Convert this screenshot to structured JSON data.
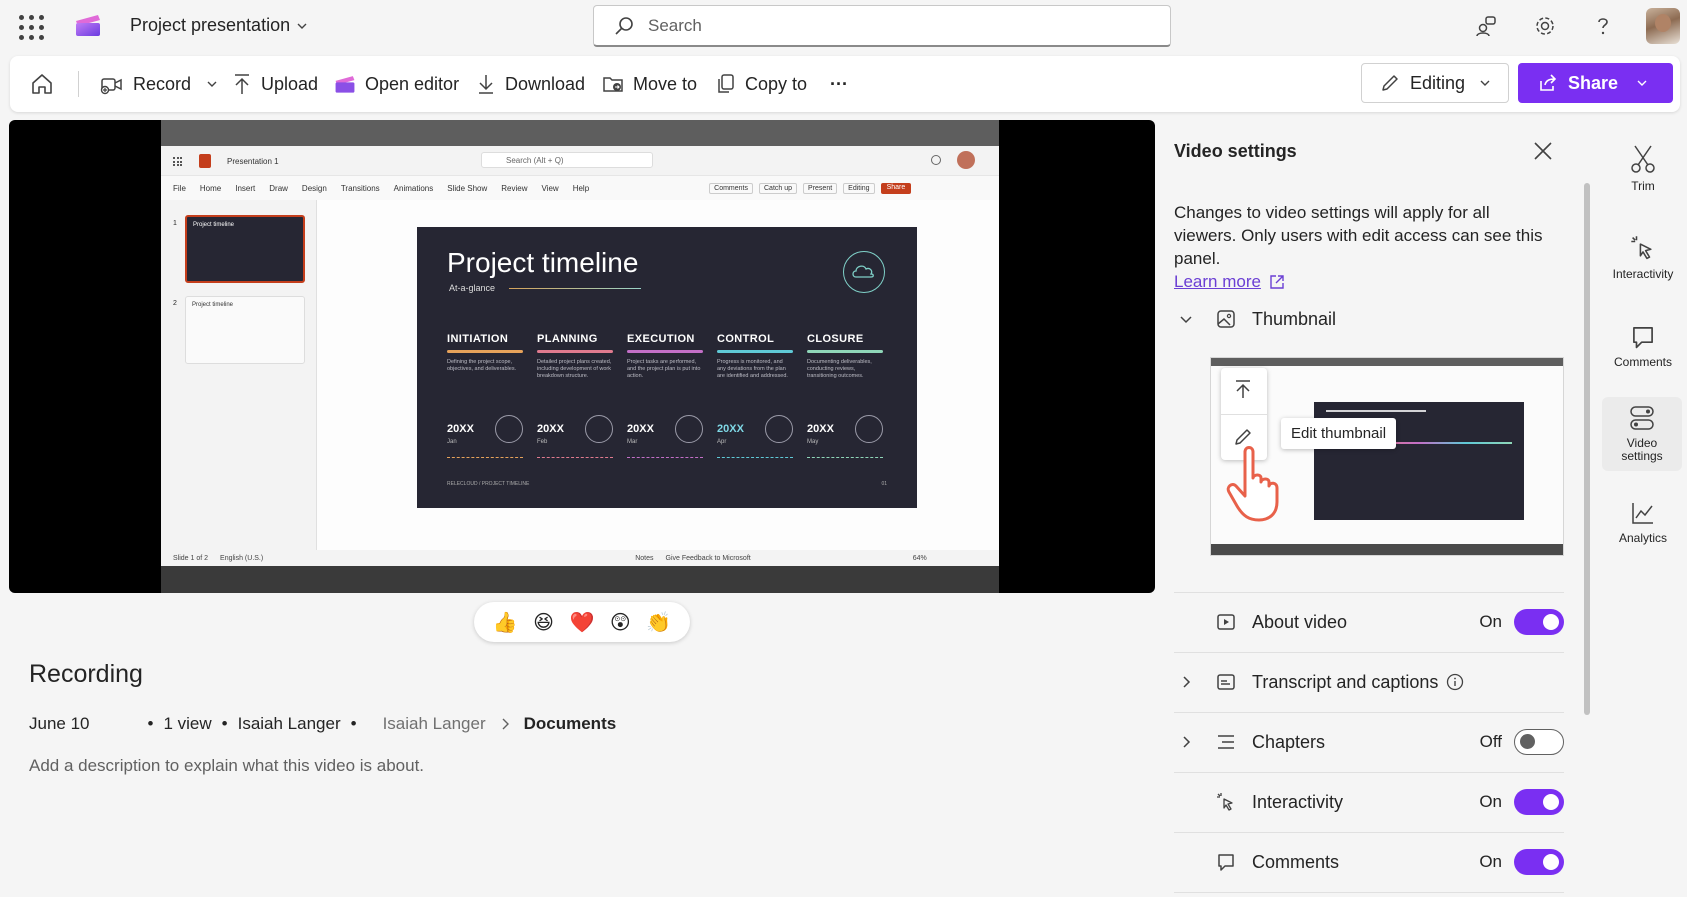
{
  "topbar": {
    "title": "Project presentation",
    "search_placeholder": "Search"
  },
  "toolbar": {
    "record": "Record",
    "upload": "Upload",
    "open_editor": "Open editor",
    "download": "Download",
    "move_to": "Move to",
    "copy_to": "Copy to",
    "more": "···",
    "editing": "Editing",
    "share": "Share"
  },
  "video": {
    "ppt": {
      "app_title": "Presentation 1",
      "search": "Search (Alt + Q)",
      "menu": [
        "File",
        "Home",
        "Insert",
        "Draw",
        "Design",
        "Transitions",
        "Animations",
        "Slide Show",
        "Review",
        "View",
        "Help"
      ],
      "buttons": [
        "Comments",
        "Catch up",
        "Present",
        "Editing",
        "Share"
      ],
      "thumb1_title": "Project timeline",
      "thumb2_title": "Project timeline",
      "status_left": "Slide 1 of 2",
      "status_lang": "English (U.S.)",
      "status_notes": "Notes",
      "status_feedback": "Give Feedback to Microsoft",
      "status_zoom": "64%"
    },
    "slide": {
      "title": "Project timeline",
      "subtitle": "At-a-glance",
      "footer": "RELECLOUD / PROJECT TIMELINE",
      "page": "01",
      "phases": [
        {
          "name": "INITIATION",
          "color": "#e6a25a",
          "desc": "Defining the project scope, objectives, and deliverables.",
          "year": "20XX",
          "month": "Jan"
        },
        {
          "name": "PLANNING",
          "color": "#e07a8e",
          "desc": "Detailed project plans created, including development of work breakdown structure.",
          "year": "20XX",
          "month": "Feb"
        },
        {
          "name": "EXECUTION",
          "color": "#c36fc7",
          "desc": "Project tasks are performed, and the project plan is put into action.",
          "year": "20XX",
          "month": "Mar"
        },
        {
          "name": "CONTROL",
          "color": "#5fc9d6",
          "desc": "Progress is monitored, and any deviations from the plan are identified and addressed.",
          "year": "20XX",
          "month": "Apr"
        },
        {
          "name": "CLOSURE",
          "color": "#8fd6b8",
          "desc": "Documenting deliverables, conducting reviews, transitioning outcomes.",
          "year": "20XX",
          "month": "May"
        }
      ]
    }
  },
  "reactions": [
    "👍",
    "😆",
    "❤️",
    "😲",
    "👏"
  ],
  "info": {
    "title": "Recording",
    "date": "June 10",
    "views": "1 view",
    "author": "Isaiah Langer",
    "path_owner": "Isaiah Langer",
    "path_folder": "Documents",
    "description": "Add a description to explain what this video is about."
  },
  "settings": {
    "title": "Video settings",
    "intro": "Changes to video settings will apply for all viewers. Only users with edit access can see this panel.",
    "learn_more": "Learn more",
    "thumbnail_label": "Thumbnail",
    "edit_thumbnail": "Edit thumbnail",
    "about_video": {
      "label": "About video",
      "state": "On",
      "on": true
    },
    "transcript": {
      "label": "Transcript and captions"
    },
    "chapters": {
      "label": "Chapters",
      "state": "Off",
      "on": false
    },
    "interactivity": {
      "label": "Interactivity",
      "state": "On",
      "on": true
    },
    "comments": {
      "label": "Comments",
      "state": "On",
      "on": true
    }
  },
  "rail": {
    "trim": "Trim",
    "interactivity": "Interactivity",
    "comments": "Comments",
    "video_settings": "Video settings",
    "analytics": "Analytics"
  },
  "colors": {
    "accent": "#7a2ff2",
    "link": "#6b3fd4"
  }
}
